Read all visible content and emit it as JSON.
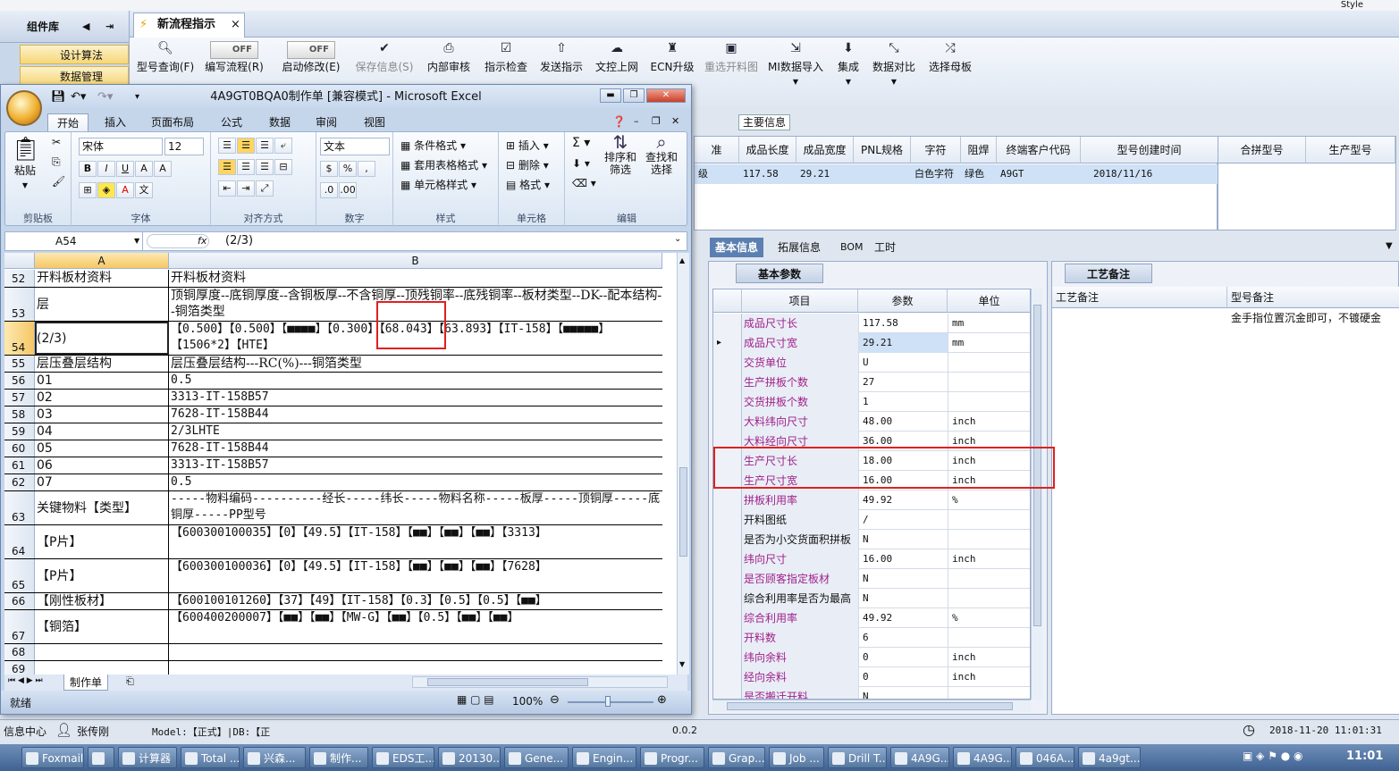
{
  "top_style": "Style",
  "left_panel": {
    "title": "组件库",
    "items": [
      "设计算法",
      "数据管理"
    ]
  },
  "doc_tab": {
    "label": "新流程指示",
    "close": "×"
  },
  "toolbar": [
    {
      "icon": "search-icon",
      "label": "型号查询(F)"
    },
    {
      "icon": "toggle",
      "label": "编写流程(R)",
      "toggle": "OFF"
    },
    {
      "icon": "toggle",
      "label": "启动修改(E)",
      "toggle": "OFF"
    },
    {
      "icon": "check-icon",
      "label": "保存信息(S)",
      "disabled": true
    },
    {
      "icon": "print-icon",
      "label": "内部审核"
    },
    {
      "icon": "checkbox-icon",
      "label": "指示检查"
    },
    {
      "icon": "upload-icon",
      "label": "发送指示"
    },
    {
      "icon": "cloud-upload-icon",
      "label": "文控上网"
    },
    {
      "icon": "ecn-icon",
      "label": "ECN升级"
    },
    {
      "icon": "image-icon",
      "label": "重选开料图",
      "disabled": true
    },
    {
      "icon": "import-icon",
      "label": "MI数据导入"
    },
    {
      "icon": "download-icon",
      "label": "集成"
    },
    {
      "icon": "compare-icon",
      "label": "数据对比"
    },
    {
      "icon": "shuffle-icon",
      "label": "选择母板"
    }
  ],
  "main_info_label": "主要信息",
  "upper_grid": {
    "headers": [
      "准",
      "成品长度",
      "成品宽度",
      "PNL规格",
      "字符",
      "阻焊",
      "终端客户代码",
      "型号创建时间"
    ],
    "row": [
      "级",
      "117.58",
      "29.21",
      "",
      "白色字符",
      "绿色",
      "A9GT",
      "2018/11/16"
    ]
  },
  "merge_grid": {
    "headers": [
      "合拼型号",
      "生产型号"
    ]
  },
  "bottom_tabs": [
    "基本信息",
    "拓展信息",
    "BOM",
    "工时"
  ],
  "basic_panel": {
    "title": "基本参数",
    "headers": [
      "项目",
      "参数",
      "单位"
    ],
    "rows": [
      {
        "name": "成品尺寸长",
        "value": "117.58",
        "unit": "mm",
        "mag": true
      },
      {
        "name": "成品尺寸宽",
        "value": "29.21",
        "unit": "mm",
        "mag": true
      },
      {
        "name": "交货单位",
        "value": "U",
        "unit": "",
        "mag": true
      },
      {
        "name": "生产拼板个数",
        "value": "27",
        "unit": "",
        "mag": true
      },
      {
        "name": "交货拼板个数",
        "value": "1",
        "unit": "",
        "mag": true
      },
      {
        "name": "大料纬向尺寸",
        "value": "48.00",
        "unit": "inch",
        "mag": true
      },
      {
        "name": "大料经向尺寸",
        "value": "36.00",
        "unit": "inch",
        "mag": true
      },
      {
        "name": "生产尺寸长",
        "value": "18.00",
        "unit": "inch",
        "mag": true
      },
      {
        "name": "生产尺寸宽",
        "value": "16.00",
        "unit": "inch",
        "mag": true
      },
      {
        "name": "拼板利用率",
        "value": "49.92",
        "unit": "%",
        "mag": true
      },
      {
        "name": "开料图纸",
        "value": "/",
        "unit": "",
        "mag": false
      },
      {
        "name": "是否为小交货面积拼板",
        "value": "N",
        "unit": "",
        "mag": false
      },
      {
        "name": "纬向尺寸",
        "value": "16.00",
        "unit": "inch",
        "mag": true
      },
      {
        "name": "是否顾客指定板材",
        "value": "N",
        "unit": "",
        "mag": true
      },
      {
        "name": "综合利用率是否为最高",
        "value": "N",
        "unit": "",
        "mag": false
      },
      {
        "name": "综合利用率",
        "value": "49.92",
        "unit": "%",
        "mag": true
      },
      {
        "name": "开料数",
        "value": "6",
        "unit": "",
        "mag": true
      },
      {
        "name": "纬向余料",
        "value": "0",
        "unit": "inch",
        "mag": true
      },
      {
        "name": "经向余料",
        "value": "0",
        "unit": "inch",
        "mag": true
      },
      {
        "name": "是否搬迁开料",
        "value": "N",
        "unit": "",
        "mag": true
      }
    ]
  },
  "craft_panel": {
    "title": "工艺备注",
    "headers": [
      "工艺备注",
      "型号备注"
    ],
    "model_note": "金手指位置沉金即可，不镀硬金"
  },
  "statusbar": {
    "info_center": "信息中心",
    "user": "张传刚",
    "model_text": "Model:【正式】|DB:【正",
    "version": "0.0.2",
    "datetime": "2018-11-20 11:01:31"
  },
  "taskbar": {
    "items": [
      "Foxmail",
      "",
      "计算器",
      "Total ...",
      "兴森...",
      "制作...",
      "EDS工...",
      "20130...",
      "Gene...",
      "Engin...",
      "Progr...",
      "Grap...",
      "Job ...",
      "Drill T...",
      "4A9G...",
      "4A9G...",
      "046A...",
      "4a9gt..."
    ],
    "clock": "11:01"
  },
  "excel": {
    "title": "4A9GT0BQA0制作单  [兼容模式] - Microsoft Excel",
    "ribbon_tabs": [
      "开始",
      "插入",
      "页面布局",
      "公式",
      "数据",
      "审阅",
      "视图"
    ],
    "groups": {
      "clipboard": "剪贴板",
      "font": "字体",
      "align": "对齐方式",
      "number": "数字",
      "style": "样式",
      "cells": "单元格",
      "edit": "编辑"
    },
    "paste": "粘贴",
    "font_name": "宋体",
    "font_size": "12",
    "number_format": "文本",
    "style_btns": [
      "条件格式",
      "套用表格格式",
      "单元格样式"
    ],
    "cell_btns": [
      "插入",
      "删除",
      "格式"
    ],
    "edit_btns": [
      "排序和筛选",
      "查找和选择"
    ],
    "name_box": "A54",
    "formula": "(2/3)",
    "fx": "fx",
    "col_headers": [
      "A",
      "B"
    ],
    "rows": [
      {
        "n": "52",
        "a": "开料板材资料",
        "b": "开料板材资料",
        "h": 20
      },
      {
        "n": "53",
        "a": "层",
        "b": "顶铜厚度--底铜厚度--含铜板厚--不含铜厚--顶残铜率--底残铜率--板材类型--DK--配本结构--铜箔类型",
        "h": 38
      },
      {
        "n": "54",
        "a": "(2/3)",
        "b": "【0.500】【0.500】【■■■■】【0.300】【68.043】【63.893】【IT-158】【■■■■■】【1506*2】【HTE】",
        "h": 38
      },
      {
        "n": "55",
        "a": "层压叠层结构",
        "b": "层压叠层结构---RC(%)---铜箔类型",
        "h": 19
      },
      {
        "n": "56",
        "a": "01",
        "b": "0.5",
        "h": 19
      },
      {
        "n": "57",
        "a": "02",
        "b": "3313-IT-158B57",
        "h": 19
      },
      {
        "n": "58",
        "a": "03",
        "b": "7628-IT-158B44",
        "h": 19
      },
      {
        "n": "59",
        "a": "04",
        "b": "2/3LHTE",
        "h": 19
      },
      {
        "n": "60",
        "a": "05",
        "b": "7628-IT-158B44",
        "h": 19
      },
      {
        "n": "61",
        "a": "06",
        "b": "3313-IT-158B57",
        "h": 19
      },
      {
        "n": "62",
        "a": "07",
        "b": "0.5",
        "h": 19
      },
      {
        "n": "63",
        "a": "关键物料【类型】",
        "b": "-----物料编码----------经长-----纬长-----物料名称-----板厚-----顶铜厚-----底铜厚-----PP型号",
        "h": 38
      },
      {
        "n": "64",
        "a": "【P片】",
        "b": "【600300100035】【0】【49.5】【IT-158】【■■】【■■】【■■】【3313】",
        "h": 38
      },
      {
        "n": "65",
        "a": "【P片】",
        "b": "【600300100036】【0】【49.5】【IT-158】【■■】【■■】【■■】【7628】",
        "h": 38
      },
      {
        "n": "66",
        "a": "【刚性板材】",
        "b": "【600100101260】【37】【49】【IT-158】【0.3】【0.5】【0.5】【■■】",
        "h": 19
      },
      {
        "n": "67",
        "a": "【铜箔】",
        "b": "【600400200007】【■■】【■■】【MW-G】【■■】【0.5】【■■】【■■】",
        "h": 38
      },
      {
        "n": "68",
        "a": "",
        "b": "",
        "h": 19
      },
      {
        "n": "69",
        "a": "",
        "b": "",
        "h": 19
      }
    ],
    "sheet_tab": "制作单",
    "status_ready": "就绪",
    "zoom": "100%"
  }
}
